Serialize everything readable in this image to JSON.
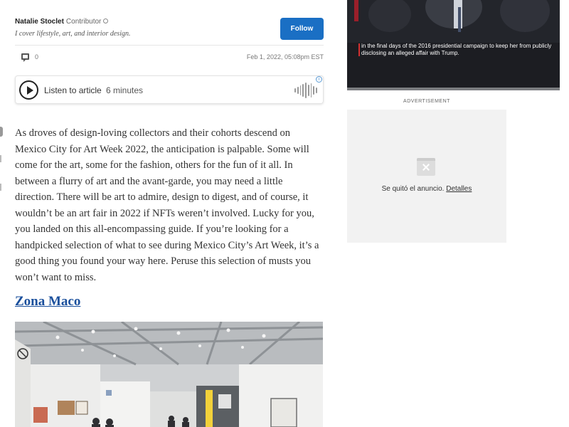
{
  "author": {
    "name": "Natalie Stoclet",
    "role": "Contributor",
    "bio": "I cover lifestyle, art, and interior design.",
    "follow_label": "Follow"
  },
  "meta": {
    "comment_count": "0",
    "published": "Feb 1, 2022, 05:08pm EST"
  },
  "listen": {
    "label": "Listen to article",
    "duration": "6 minutes",
    "ad_icon": "i"
  },
  "article": {
    "paragraph": "As droves of design-loving collectors and their cohorts descend on Mexico City for Art Week 2022, the anticipation is palpable. Some will come for the art, some for the fashion, others for the fun of it all. In between a flurry of art and the avant-garde, you may need a little direction. There will be art to admire, design to digest, and of course, it wouldn’t be an art fair in 2022 if NFTs weren’t involved. Lucky for you, you landed on this all-encompassing guide. If you’re looking for a handpicked selection of what to see during Mexico City’s Art Week, it’s a good thing you found your way here. Peruse this selection of musts you won’t want to miss.",
    "section_heading": "Zona Maco"
  },
  "video": {
    "caption": "in the final days of the 2016 presidential campaign to keep her from publicly disclosing an alleged affair with Trump."
  },
  "advertisement": {
    "label": "ADVERTISEMENT",
    "removed_text": "Se quitó el anuncio.",
    "details_link": "Detalles"
  },
  "colors": {
    "follow_button": "#1a6fc4",
    "heading_link": "#1a4f9c",
    "caption_accent": "#d32f2f"
  },
  "icons": {
    "comment": "comment-icon",
    "play": "play-icon",
    "waveform": "waveform-icon",
    "ad_info": "info-icon",
    "ad_removed": "ad-removed-icon"
  }
}
